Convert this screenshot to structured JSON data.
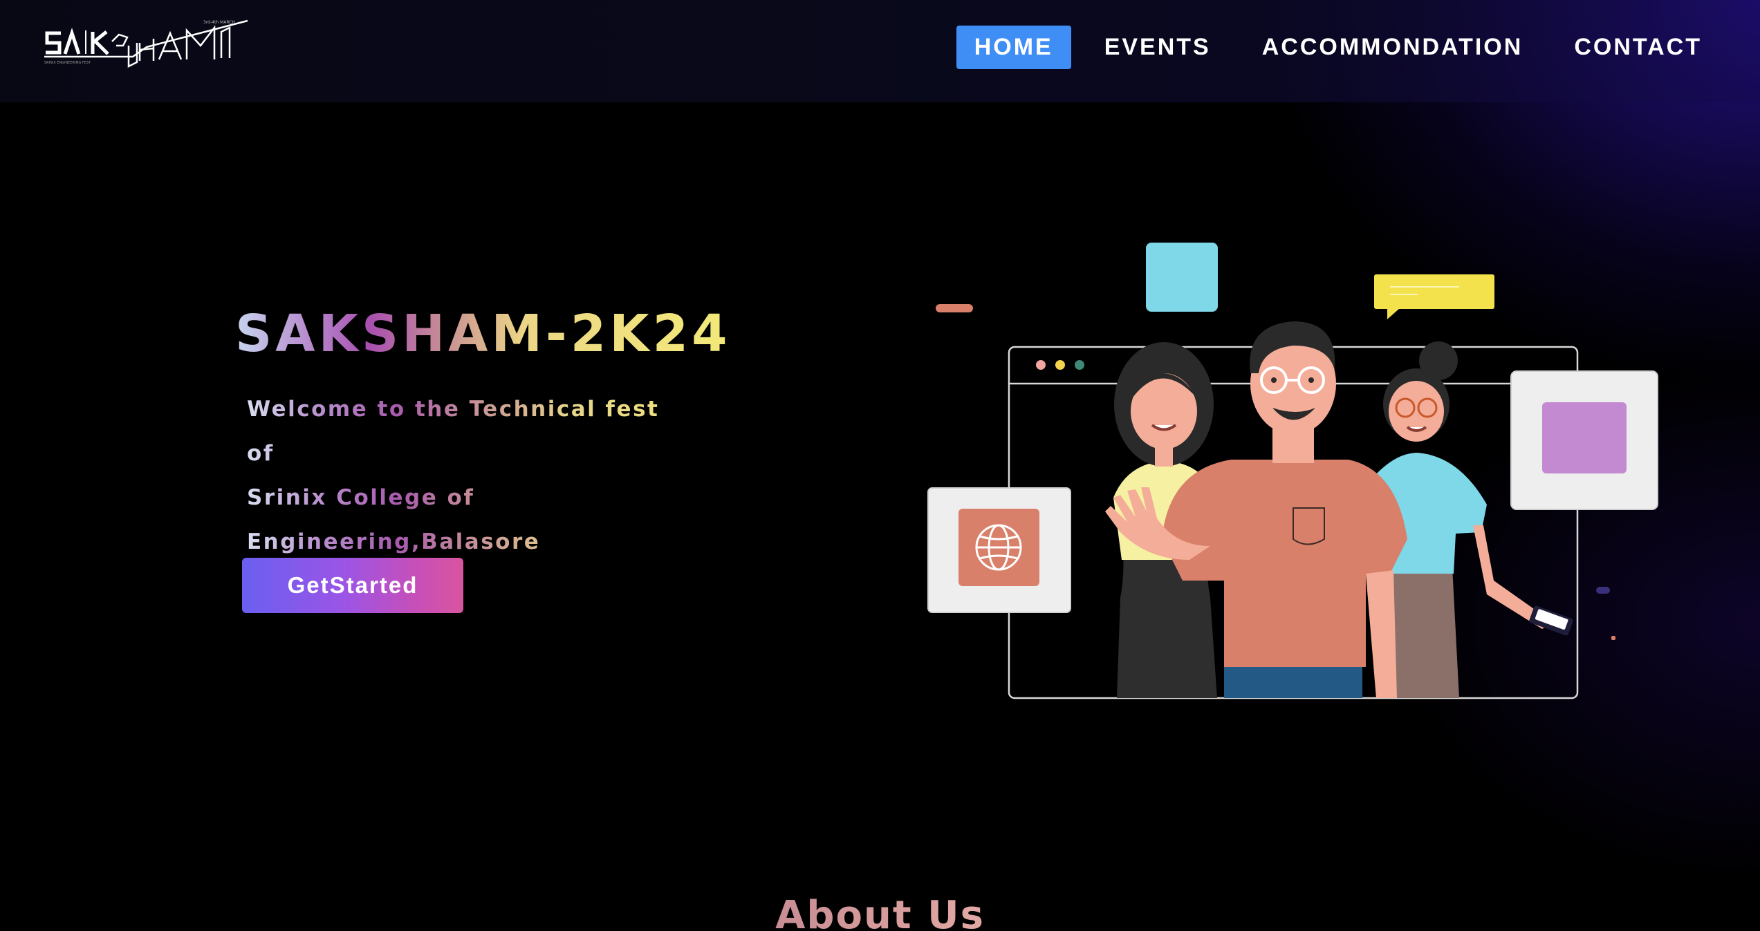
{
  "brand": {
    "logo_text": "SAKSHAM",
    "logo_year": "2024",
    "logo_date": "3rd-4th MARCH",
    "logo_tagline": "SRINIX ENGINEERING FEST"
  },
  "nav": {
    "items": [
      {
        "label": "HOME",
        "active": true
      },
      {
        "label": "EVENTS",
        "active": false
      },
      {
        "label": "ACCOMMONDATION",
        "active": false
      },
      {
        "label": "CONTACT",
        "active": false
      }
    ]
  },
  "hero": {
    "title": "SAKSHAM-2K24",
    "subtitle_lines": [
      "Welcome to the Technical fest of",
      "Srinix College of",
      "Engineering,Balasore"
    ],
    "cta_label": "GetStarted"
  },
  "about": {
    "title": "About Us"
  },
  "colors": {
    "nav_active_bg": "#3f8ef5",
    "cta_gradient_start": "#6a5ff0",
    "cta_gradient_end": "#d8559f",
    "title_gradient_start": "#c7d5ef",
    "title_gradient_end": "#f3ea78",
    "background": "#000000",
    "glow": "#2812a0"
  },
  "illustration": {
    "icons": [
      "globe-icon",
      "chat-bubble-icon",
      "browser-window-icon",
      "phone-icon"
    ]
  }
}
